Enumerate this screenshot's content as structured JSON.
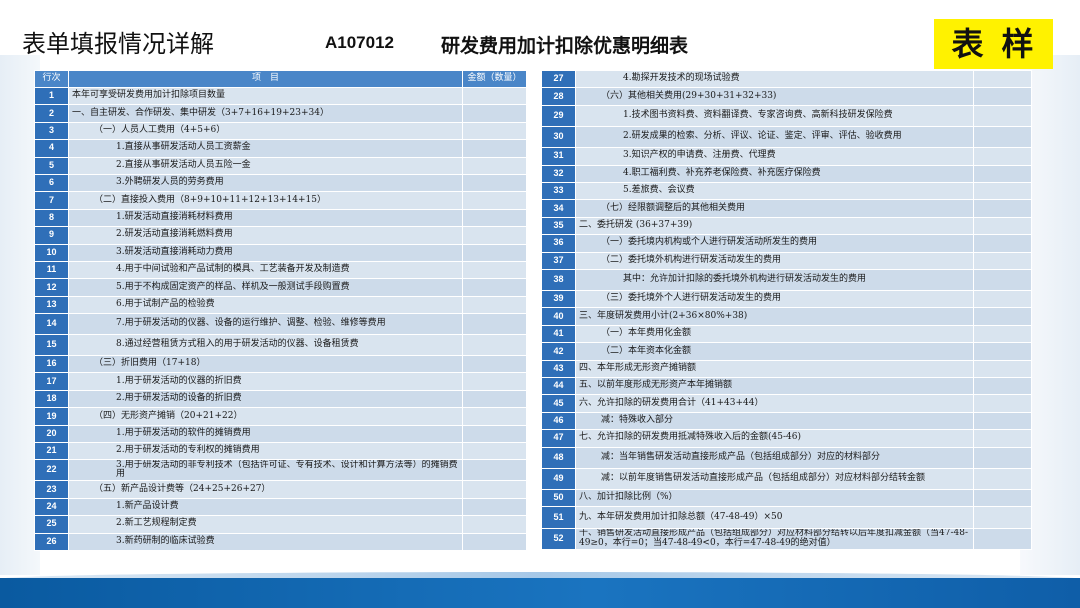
{
  "header": {
    "title": "表单填报情况详解",
    "code": "A107012",
    "table_name": "研发费用加计扣除优惠明细表",
    "sample_badge": "表样"
  },
  "table_headers": {
    "row_no": "行次",
    "item": "项　目",
    "amount": "金额（数量）"
  },
  "left_rows": [
    {
      "no": "1",
      "indent": 0,
      "text": "本年可享受研发费用加计扣除项目数量"
    },
    {
      "no": "2",
      "indent": 0,
      "text": "一、自主研发、合作研发、集中研发（3+7+16+19+23+34）"
    },
    {
      "no": "3",
      "indent": 1,
      "text": "（一）人员人工费用（4+5+6）"
    },
    {
      "no": "4",
      "indent": 2,
      "text": "1.直接从事研发活动人员工资薪金"
    },
    {
      "no": "5",
      "indent": 2,
      "text": "2.直接从事研发活动人员五险一金"
    },
    {
      "no": "6",
      "indent": 2,
      "text": "3.外聘研发人员的劳务费用"
    },
    {
      "no": "7",
      "indent": 1,
      "text": "（二）直接投入费用（8+9+10+11+12+13+14+15）"
    },
    {
      "no": "8",
      "indent": 2,
      "text": "1.研发活动直接消耗材料费用"
    },
    {
      "no": "9",
      "indent": 2,
      "text": "2.研发活动直接消耗燃料费用"
    },
    {
      "no": "10",
      "indent": 2,
      "text": "3.研发活动直接消耗动力费用"
    },
    {
      "no": "11",
      "indent": 2,
      "text": "4.用于中间试验和产品试制的模具、工艺装备开发及制造费"
    },
    {
      "no": "12",
      "indent": 2,
      "text": "5.用于不构成固定资产的样品、样机及一般测试手段购置费"
    },
    {
      "no": "13",
      "indent": 2,
      "text": "6.用于试制产品的检验费"
    },
    {
      "no": "14",
      "indent": 2,
      "text": "7.用于研发活动的仪器、设备的运行维护、调整、检验、维修等费用",
      "tall": true
    },
    {
      "no": "15",
      "indent": 2,
      "text": "8.通过经营租赁方式租入的用于研发活动的仪器、设备租赁费",
      "tall": true
    },
    {
      "no": "16",
      "indent": 1,
      "text": "（三）折旧费用（17+18）"
    },
    {
      "no": "17",
      "indent": 2,
      "text": "1.用于研发活动的仪器的折旧费"
    },
    {
      "no": "18",
      "indent": 2,
      "text": "2.用于研发活动的设备的折旧费"
    },
    {
      "no": "19",
      "indent": 1,
      "text": "（四）无形资产摊销（20+21+22）"
    },
    {
      "no": "20",
      "indent": 2,
      "text": "1.用于研发活动的软件的摊销费用"
    },
    {
      "no": "21",
      "indent": 2,
      "text": "2.用于研发活动的专利权的摊销费用"
    },
    {
      "no": "22",
      "indent": 2,
      "text": "3.用于研发活动的非专利技术（包括许可证、专有技术、设计和计算方法等）的摊销费用",
      "tall": true,
      "wrap": true
    },
    {
      "no": "23",
      "indent": 1,
      "text": "（五）新产品设计费等（24+25+26+27）"
    },
    {
      "no": "24",
      "indent": 2,
      "text": "1.新产品设计费"
    },
    {
      "no": "25",
      "indent": 2,
      "text": "2.新工艺规程制定费"
    },
    {
      "no": "26",
      "indent": 2,
      "text": "3.新药研制的临床试验费"
    }
  ],
  "right_rows": [
    {
      "no": "27",
      "indent": 2,
      "text": "4.勘探开发技术的现场试验费"
    },
    {
      "no": "28",
      "indent": 1,
      "text": "（六）其他相关费用(29+30+31+32+33)"
    },
    {
      "no": "29",
      "indent": 2,
      "text": "1.技术图书资料费、资料翻译费、专家咨询费、高新科技研发保险费",
      "tall": true
    },
    {
      "no": "30",
      "indent": 2,
      "text": "2.研发成果的检索、分析、评议、论证、鉴定、评审、评估、验收费用",
      "tall": true
    },
    {
      "no": "31",
      "indent": 2,
      "text": "3.知识产权的申请费、注册费、代理费"
    },
    {
      "no": "32",
      "indent": 2,
      "text": "4.职工福利费、补充养老保险费、补充医疗保险费"
    },
    {
      "no": "33",
      "indent": 2,
      "text": "5.差旅费、会议费"
    },
    {
      "no": "34",
      "indent": 1,
      "text": "（七）经限额调整后的其他相关费用"
    },
    {
      "no": "35",
      "indent": 0,
      "text": "二、委托研发 (36+37+39)"
    },
    {
      "no": "36",
      "indent": 1,
      "text": "（一）委托境内机构或个人进行研发活动所发生的费用"
    },
    {
      "no": "37",
      "indent": 1,
      "text": "（二）委托境外机构进行研发活动发生的费用"
    },
    {
      "no": "38",
      "indent": 2,
      "text": "其中：允许加计扣除的委托境外机构进行研发活动发生的费用",
      "tall": true
    },
    {
      "no": "39",
      "indent": 1,
      "text": "（三）委托境外个人进行研发活动发生的费用"
    },
    {
      "no": "40",
      "indent": 0,
      "text": "三、年度研发费用小计(2+36×80%+38)"
    },
    {
      "no": "41",
      "indent": 1,
      "text": "（一）本年费用化金额"
    },
    {
      "no": "42",
      "indent": 1,
      "text": "（二）本年资本化金额"
    },
    {
      "no": "43",
      "indent": 0,
      "text": "四、本年形成无形资产摊销额"
    },
    {
      "no": "44",
      "indent": 0,
      "text": "五、以前年度形成无形资产本年摊销额"
    },
    {
      "no": "45",
      "indent": 0,
      "text": "六、允许扣除的研发费用合计（41+43+44）"
    },
    {
      "no": "46",
      "indent": 1,
      "text": "减：特殊收入部分"
    },
    {
      "no": "47",
      "indent": 0,
      "text": "七、允许扣除的研发费用抵减特殊收入后的金额(45-46)"
    },
    {
      "no": "48",
      "indent": 1,
      "text": "减：当年销售研发活动直接形成产品（包括组成部分）对应的材料部分",
      "tall": true
    },
    {
      "no": "49",
      "indent": 1,
      "text": "减：以前年度销售研发活动直接形成产品（包括组成部分）对应材料部分结转金额",
      "tall": true
    },
    {
      "no": "50",
      "indent": 0,
      "text": "八、加计扣除比例（%）"
    },
    {
      "no": "51",
      "indent": 0,
      "text": "九、本年研发费用加计扣除总额（47-48-49）×50",
      "tall": true
    },
    {
      "no": "52",
      "indent": 0,
      "text": "十、销售研发活动直接形成产品（包括组成部分）对应材料部分结转以后年度扣减金额（当47-48-49≥0，本行=0；当47-48-49<0，本行=47-48-49的绝对值）",
      "tall": true,
      "wrap": true
    }
  ]
}
